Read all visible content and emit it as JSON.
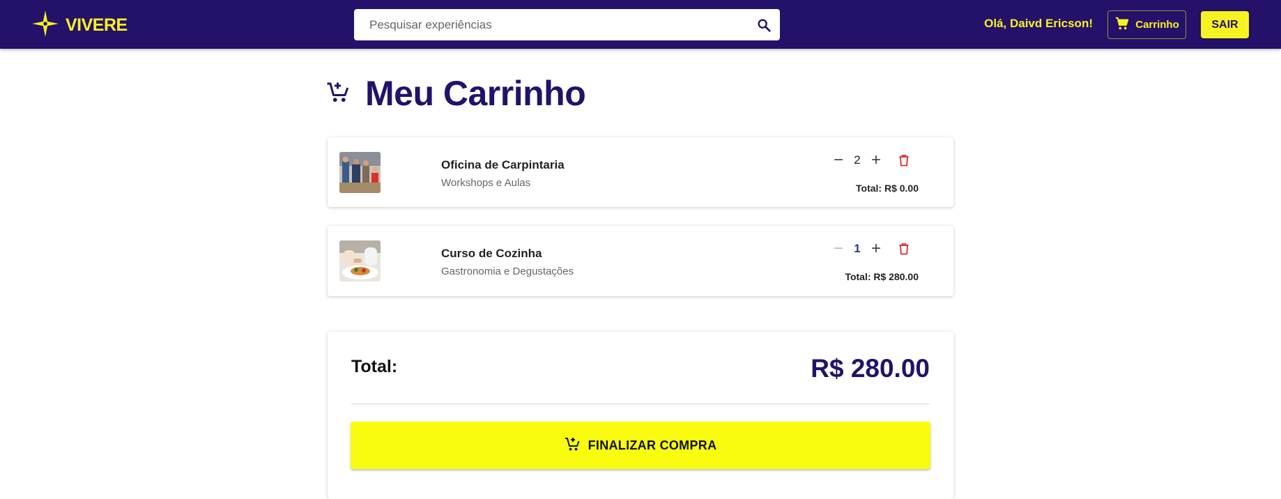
{
  "colors": {
    "brand_navy": "#24116a",
    "brand_yellow": "#f7f321",
    "checkout_yellow": "#fafc10",
    "delete_red": "#d32f2f"
  },
  "header": {
    "brand_name": "VIVERE",
    "search_placeholder": "Pesquisar experiências",
    "greeting": "Olá, Daivd Ericson!",
    "cart_label": "Carrinho",
    "logout_label": "SAIR"
  },
  "page": {
    "title": "Meu Carrinho"
  },
  "cart": {
    "items": [
      {
        "name": "Oficina de Carpintaria",
        "category": "Workshops e Aulas",
        "quantity": "2",
        "total": "Total: R$ 0.00",
        "thumbnail_icon": "workshop-photo"
      },
      {
        "name": "Curso de Cozinha",
        "category": "Gastronomia e Degustações",
        "quantity": "1",
        "total": "Total: R$ 280.00",
        "thumbnail_icon": "cooking-photo"
      }
    ]
  },
  "summary": {
    "total_label": "Total:",
    "total_value": "R$ 280.00",
    "checkout_label": "FINALIZAR COMPRA"
  },
  "icons": {
    "brand": "four-point-star-icon",
    "search": "search-icon",
    "cart": "shopping-cart-icon",
    "add_to_cart": "add-shopping-cart-icon",
    "decrease": "minus-icon",
    "increase": "plus-icon",
    "delete": "trash-icon"
  }
}
